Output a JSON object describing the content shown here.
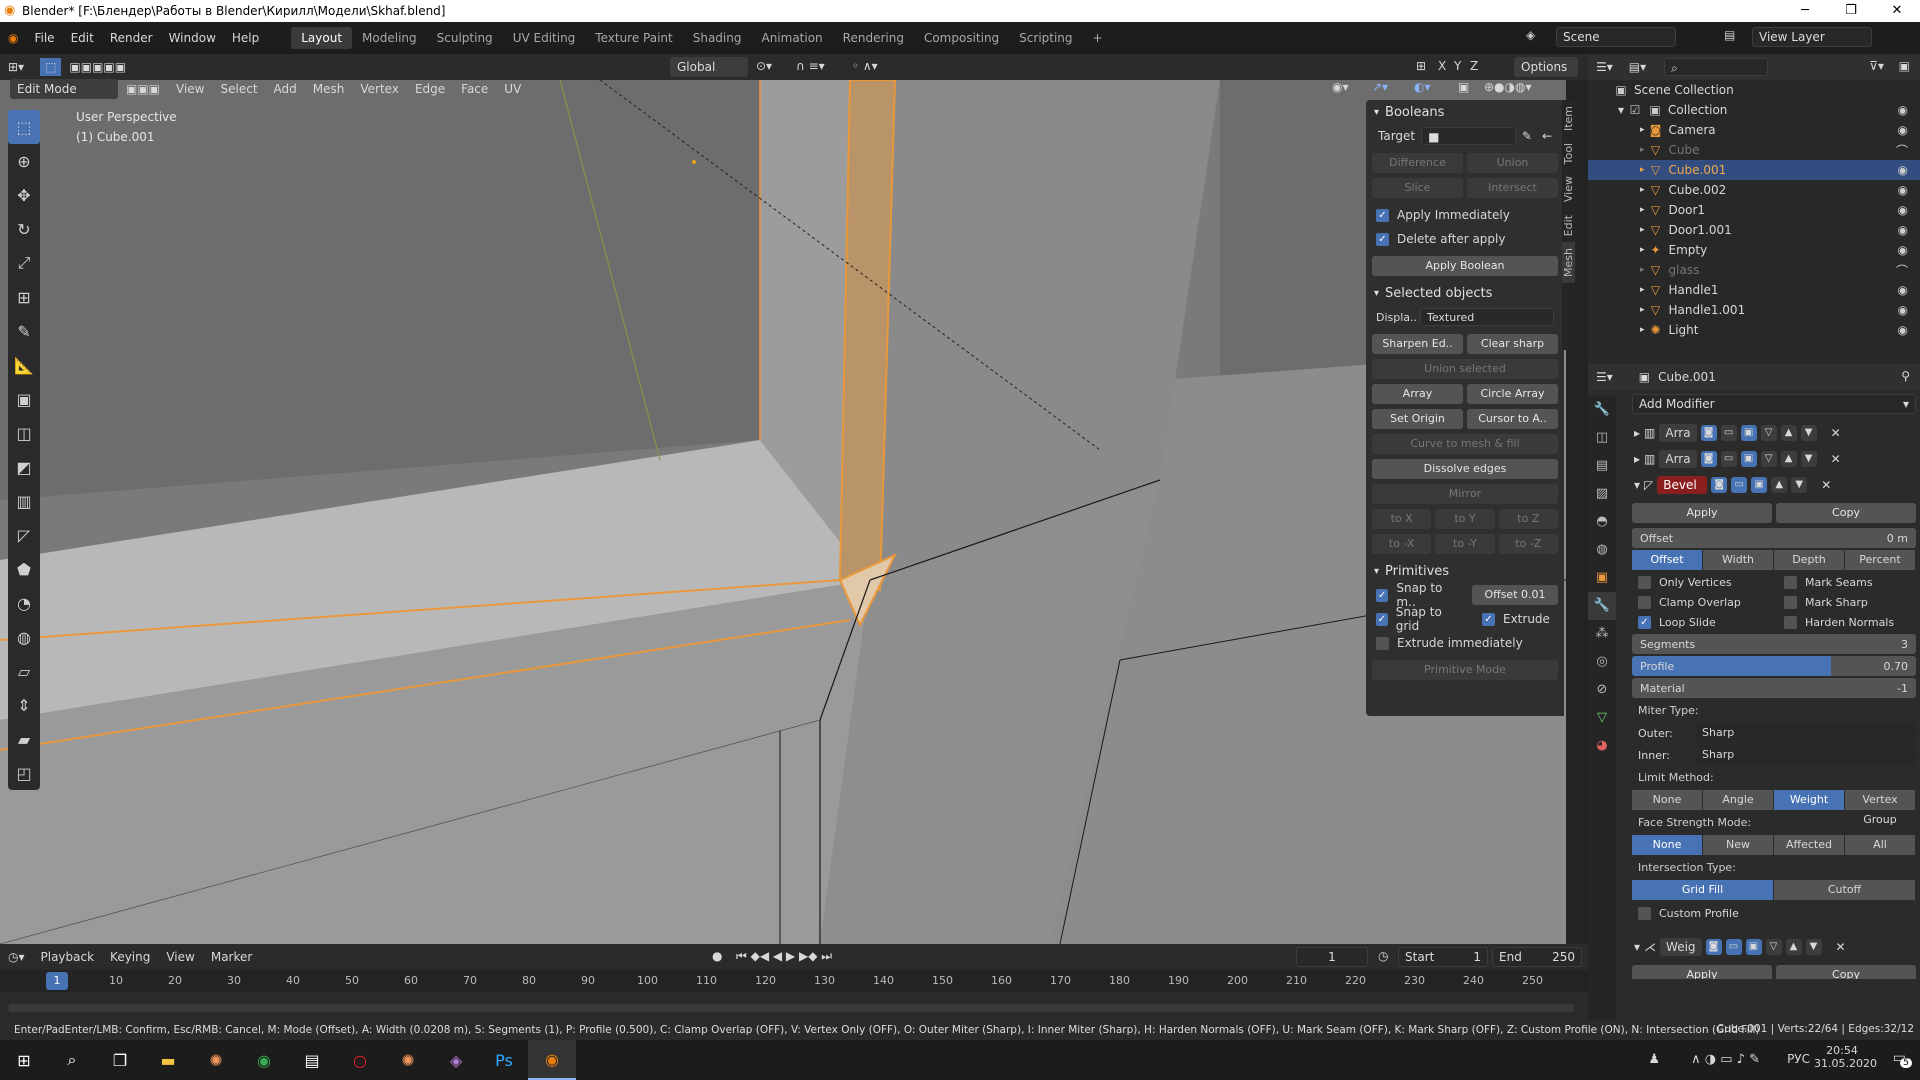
{
  "window": {
    "title": "Blender* [F:\\Блендер\\Работы в Blender\\Кирилл\\Модели\\Skhaf.blend]"
  },
  "menus": [
    "File",
    "Edit",
    "Render",
    "Window",
    "Help"
  ],
  "workspaces": [
    "Layout",
    "Modeling",
    "Sculpting",
    "UV Editing",
    "Texture Paint",
    "Shading",
    "Animation",
    "Rendering",
    "Compositing",
    "Scripting"
  ],
  "scene": {
    "name": "Scene",
    "view_layer": "View Layer"
  },
  "viewport": {
    "mode": "Edit Mode",
    "menus": [
      "View",
      "Select",
      "Add",
      "Mesh",
      "Vertex",
      "Edge",
      "Face",
      "UV"
    ],
    "orientation": "Global",
    "options": "Options",
    "perspective": "User Perspective",
    "object": "(1) Cube.001",
    "axes": [
      "X",
      "Y",
      "Z"
    ]
  },
  "side_tabs": [
    "Item",
    "Tool",
    "View",
    "Edit",
    "Mesh"
  ],
  "booleans": {
    "title": "Booleans",
    "target_label": "Target",
    "ops": [
      "Difference",
      "Union",
      "Slice",
      "Intersect"
    ],
    "apply_immediately": "Apply Immediately",
    "delete_after": "Delete after apply",
    "apply_boolean": "Apply Boolean"
  },
  "selected": {
    "title": "Selected objects",
    "display_label": "Displa..",
    "display_value": "Textured",
    "sharpen": "Sharpen Ed..",
    "clear_sharp": "Clear sharp",
    "union_selected": "Union selected",
    "array": "Array",
    "circle_array": "Circle Array",
    "set_origin": "Set Origin",
    "cursor_to": "Cursor to A..",
    "curve": "Curve to mesh & fill",
    "dissolve": "Dissolve edges",
    "mirror": "Mirror",
    "axes": [
      "to X",
      "to Y",
      "to Z",
      "to -X",
      "to -Y",
      "to -Z"
    ]
  },
  "primitives": {
    "title": "Primitives",
    "snap_mesh": "Snap to m..",
    "offset": "Offset",
    "offset_value": "0.01",
    "snap_grid": "Snap to grid",
    "extrude": "Extrude",
    "extrude_imm": "Extrude immediately",
    "mode": "Primitive Mode"
  },
  "outliner": {
    "root": "Scene Collection",
    "collection": "Collection",
    "items": [
      "Camera",
      "Cube",
      "Cube.001",
      "Cube.002",
      "Door1",
      "Door1.001",
      "Empty",
      "glass",
      "Handle1",
      "Handle1.001",
      "Light"
    ]
  },
  "properties": {
    "object": "Cube.001",
    "add_modifier": "Add Modifier",
    "mod1": "Arra",
    "mod2": "Arra",
    "bevel": "Bevel",
    "apply": "Apply",
    "copy": "Copy",
    "offset_label": "Offset",
    "offset_value": "0 m",
    "width_types": [
      "Offset",
      "Width",
      "Depth",
      "Percent"
    ],
    "only_vertices": "Only Vertices",
    "mark_seams": "Mark Seams",
    "clamp": "Clamp Overlap",
    "mark_sharp": "Mark Sharp",
    "loop_slide": "Loop Slide",
    "harden": "Harden Normals",
    "segments_label": "Segments",
    "segments_value": "3",
    "profile_label": "Profile",
    "profile_value": "0.70",
    "profile_fraction": 0.7,
    "material_label": "Material",
    "material_value": "-1",
    "miter": "Miter Type:",
    "outer_label": "Outer:",
    "outer_value": "Sharp",
    "inner_label": "Inner:",
    "inner_value": "Sharp",
    "limit": "Limit Method:",
    "limit_opts": [
      "None",
      "Angle",
      "Weight",
      "Vertex Group"
    ],
    "face_strength": "Face Strength Mode:",
    "face_opts": [
      "None",
      "New",
      "Affected",
      "All"
    ],
    "intersection": "Intersection Type:",
    "inter_opts": [
      "Grid Fill",
      "Cutoff"
    ],
    "custom_profile": "Custom Profile",
    "mod4": "Weig",
    "apply2": "Apply",
    "copy2": "Copy"
  },
  "timeline": {
    "menus": [
      "Playback",
      "Keying",
      "View",
      "Marker"
    ],
    "frame": "1",
    "start_label": "Start",
    "start": "1",
    "end_label": "End",
    "end": "250",
    "ticks": [
      "1",
      "10",
      "20",
      "30",
      "40",
      "50",
      "60",
      "70",
      "80",
      "90",
      "100",
      "110",
      "120",
      "130",
      "140",
      "150",
      "160",
      "170",
      "180",
      "190",
      "200",
      "210",
      "220",
      "230",
      "240",
      "250"
    ]
  },
  "status": {
    "text": "Enter/PadEnter/LMB: Confirm, Esc/RMB: Cancel, M: Mode (Offset), A: Width (0.0208 m), S: Segments (1), P: Profile (0.500), C: Clamp Overlap (OFF), V: Vertex Only (OFF), O: Outer Miter (Sharp), I: Inner Miter (Sharp), H: Harden Normals (OFF), U: Mark Seam (OFF), K: Mark Sharp (OFF), Z: Custom Profile (ON), N: Intersection (Grid Fill)",
    "stats": "Cube.001 | Verts:22/64 | Edges:32/12"
  },
  "taskbar": {
    "lang": "РУС",
    "time": "20:54",
    "date": "31.05.2020",
    "badge": "5"
  }
}
